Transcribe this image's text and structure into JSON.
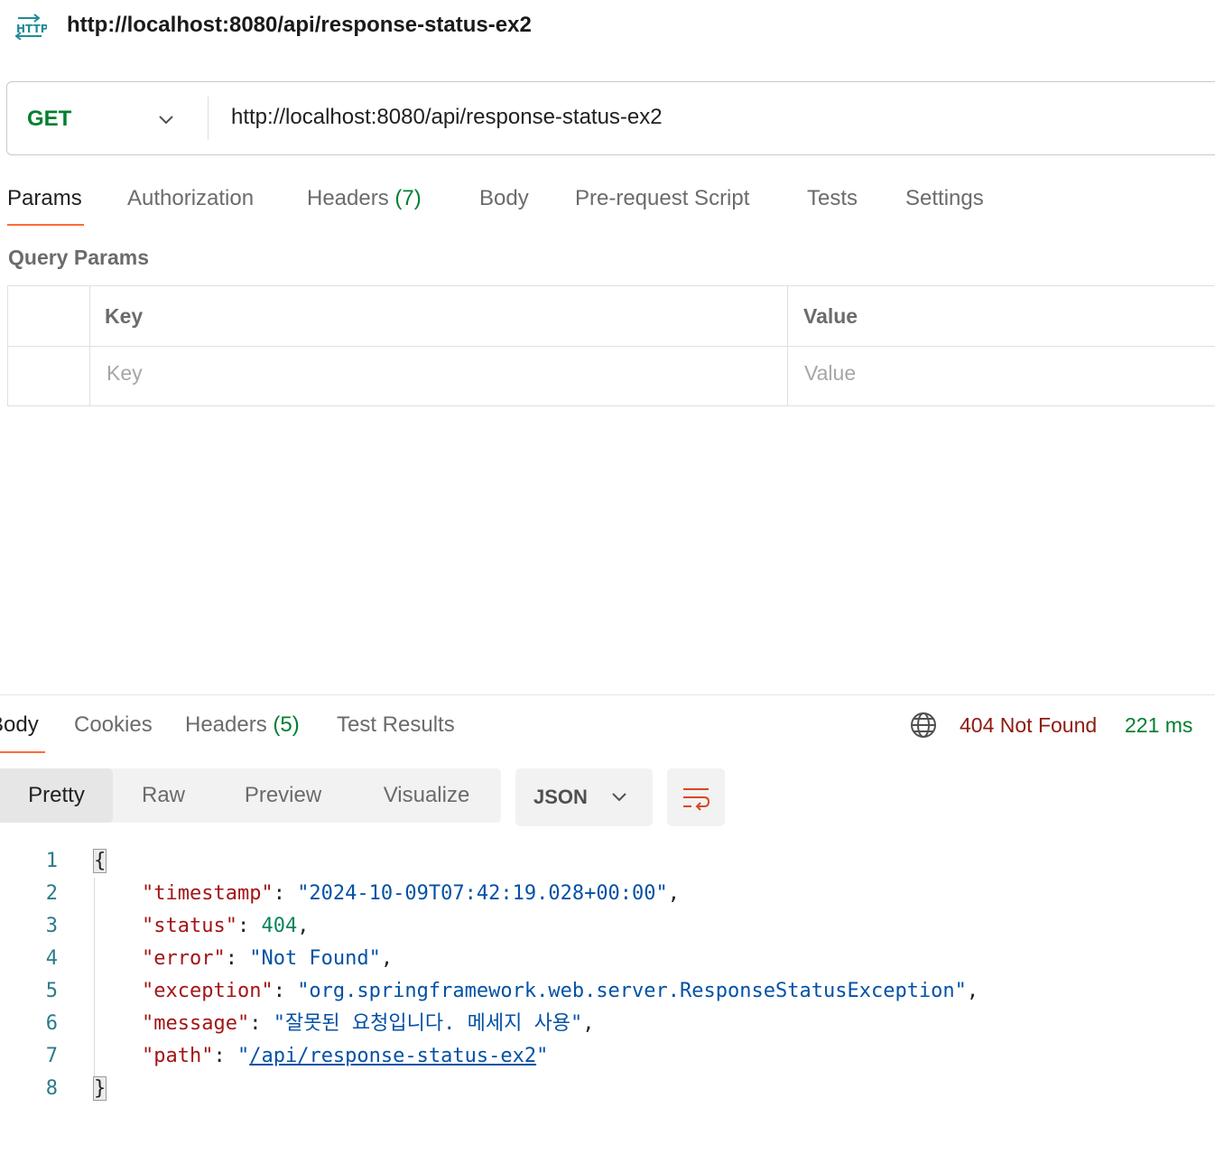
{
  "request": {
    "title": "http://localhost:8080/api/response-status-ex2",
    "method": "GET",
    "url": "http://localhost:8080/api/response-status-ex2",
    "tabs": {
      "params": "Params",
      "authorization": "Authorization",
      "headers": "Headers",
      "headers_count": "(7)",
      "body": "Body",
      "pre_request_script": "Pre-request Script",
      "tests": "Tests",
      "settings": "Settings"
    },
    "query_params": {
      "title": "Query Params",
      "key_header": "Key",
      "value_header": "Value",
      "key_placeholder": "Key",
      "value_placeholder": "Value"
    }
  },
  "response": {
    "tabs": {
      "body": "Body",
      "cookies": "Cookies",
      "headers": "Headers",
      "headers_count": "(5)",
      "test_results": "Test Results"
    },
    "status": "404 Not Found",
    "time": "221 ms",
    "view_modes": [
      "Pretty",
      "Raw",
      "Preview",
      "Visualize"
    ],
    "active_view_mode": "Pretty",
    "format": "JSON",
    "line_numbers": [
      "1",
      "2",
      "3",
      "4",
      "5",
      "6",
      "7",
      "8"
    ],
    "body_json": {
      "open_brace": "{",
      "close_brace": "}",
      "fields": [
        {
          "key": "\"timestamp\"",
          "value": "\"2024-10-09T07:42:19.028+00:00\"",
          "type": "string",
          "trail": ","
        },
        {
          "key": "\"status\"",
          "value": "404",
          "type": "number",
          "trail": ","
        },
        {
          "key": "\"error\"",
          "value": "\"Not Found\"",
          "type": "string",
          "trail": ","
        },
        {
          "key": "\"exception\"",
          "value": "\"org.springframework.web.server.ResponseStatusException\"",
          "type": "string",
          "trail": ","
        },
        {
          "key": "\"message\"",
          "value": "\"잘못된 요청입니다. 메세지 사용\"",
          "type": "string",
          "trail": ","
        },
        {
          "key": "\"path\"",
          "value_prefix": "\"",
          "value_link": "/api/response-status-ex2",
          "value_suffix": "\"",
          "type": "link",
          "trail": ""
        }
      ]
    }
  },
  "colors": {
    "accent": "#ff6c37",
    "method_get": "#007f31",
    "status_error": "#8e1a10",
    "time_ok": "#007f31",
    "json_key": "#a31515",
    "json_string": "#0451a5",
    "json_number": "#098658"
  },
  "icons": [
    "http-icon",
    "chevron-down-icon",
    "globe-icon",
    "wrap-lines-icon"
  ]
}
